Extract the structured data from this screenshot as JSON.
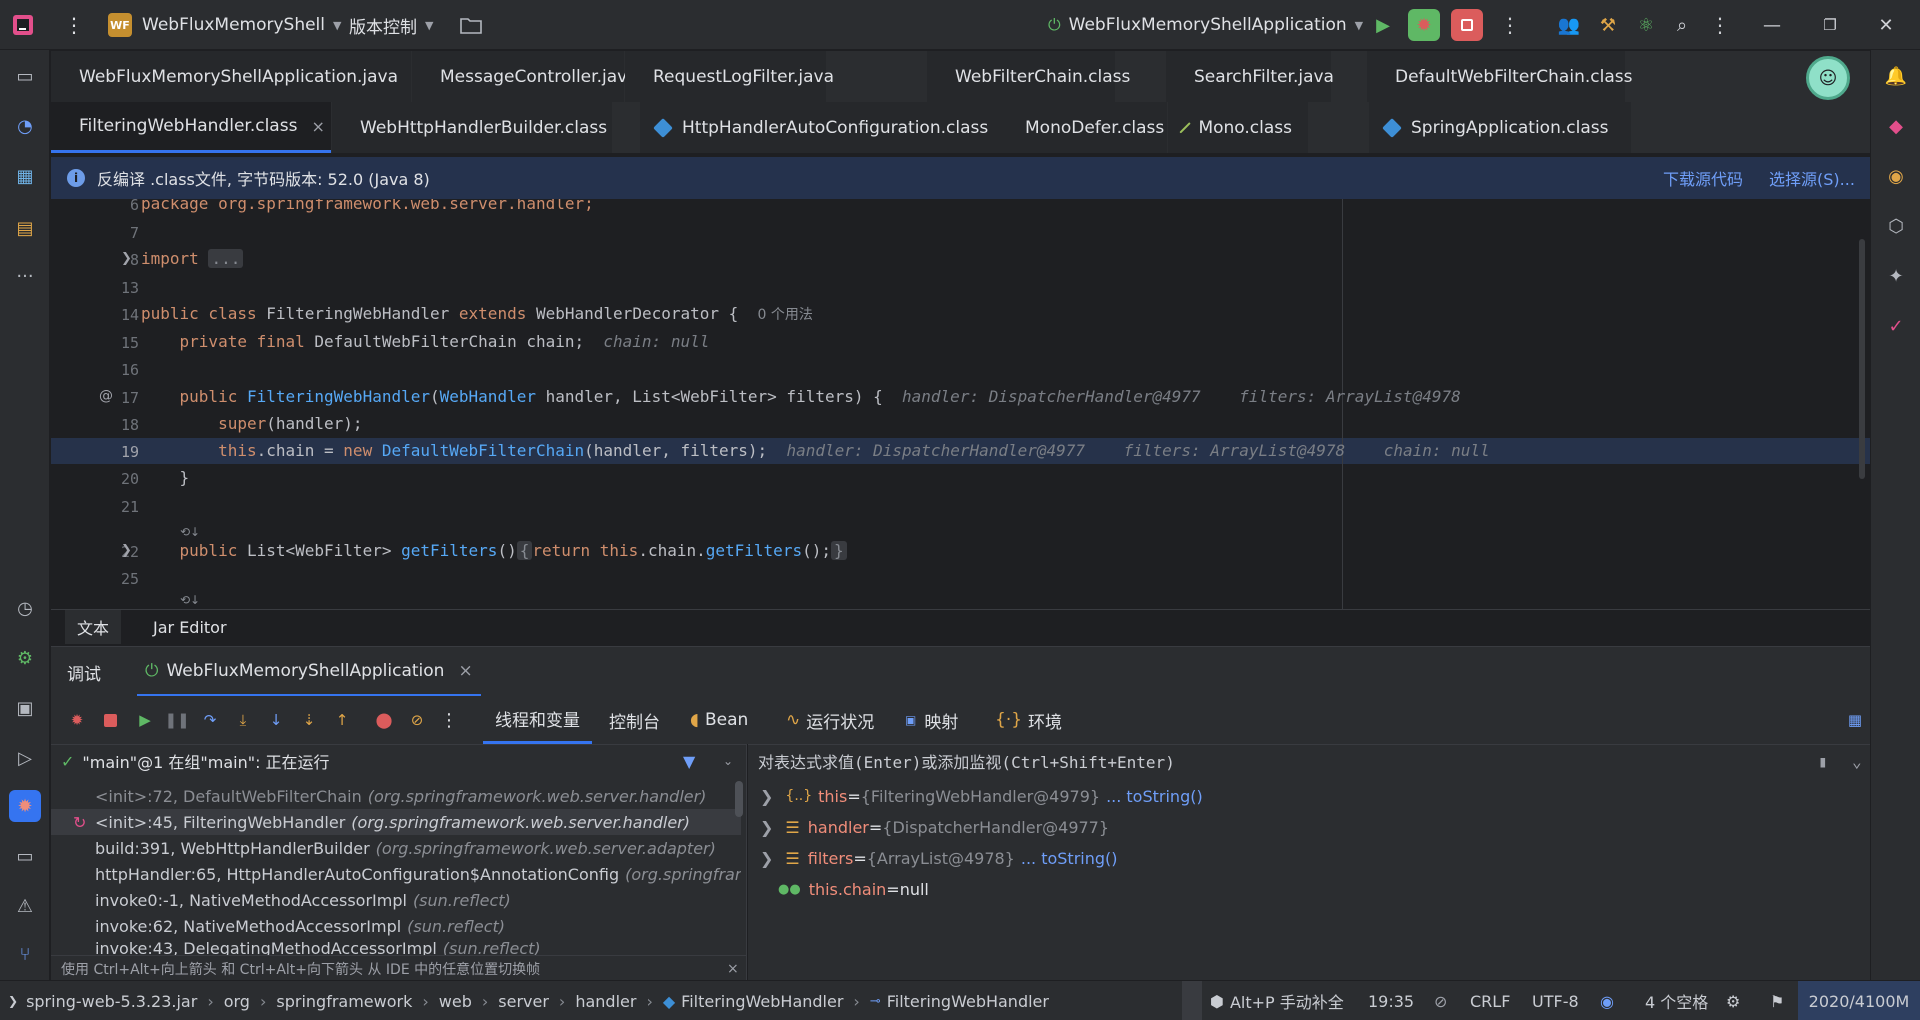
{
  "titlebar": {
    "project_badge": "WF",
    "project_name": "WebFluxMemoryShell",
    "vcs_label": "版本控制",
    "run_config": "WebFluxMemoryShellApplication"
  },
  "tabs_row1": [
    {
      "label": "WebFluxMemoryShellApplication.java",
      "icon": "spring-class-icon"
    },
    {
      "label": "MessageController.java",
      "icon": "class-icon"
    },
    {
      "label": "RequestLogFilter.java",
      "icon": "class-icon"
    },
    {
      "label": "WebFilterChain.class",
      "icon": "interface-icon"
    },
    {
      "label": "SearchFilter.java",
      "icon": "class-icon"
    },
    {
      "label": "DefaultWebFilterChain.class",
      "icon": "class-icon"
    }
  ],
  "tabs_row2": [
    {
      "label": "FilteringWebHandler.class",
      "icon": "class-icon",
      "close": "×"
    },
    {
      "label": "WebHttpHandlerBuilder.class",
      "icon": "class-icon"
    },
    {
      "label": "HttpHandlerAutoConfiguration.class",
      "icon": "class-icon"
    },
    {
      "label": "MonoDefer.class",
      "icon": "class-icon"
    },
    {
      "label": "Mono.class",
      "icon": "abstract-class-icon"
    },
    {
      "label": "SpringApplication.class",
      "icon": "class-icon"
    }
  ],
  "banner": {
    "text": "反编译 .class文件, 字节码版本: 52.0 (Java 8)",
    "download_link": "下载源代码",
    "choose_link": "选择源(S)..."
  },
  "editor": {
    "line_numbers": [
      "6",
      "7",
      "8",
      "13",
      "14",
      "15",
      "16",
      "17",
      "18",
      "19",
      "20",
      "21",
      "22",
      "25"
    ],
    "l6": "package org.springframework.web.server.handler;",
    "l8_kw": "import",
    "l8_fold": "...",
    "l14_a": "public class",
    "l14_b": "FilteringWebHandler",
    "l14_c": "extends",
    "l14_d": "WebHandlerDecorator {",
    "l14_usage": "0 个用法",
    "l15_a": "private final",
    "l15_b": "DefaultWebFilterChain chain;",
    "l15_hint": "chain: null",
    "l17_a": "public",
    "l17_b": "FilteringWebHandler",
    "l17_c": "(",
    "l17_d": "WebHandler",
    "l17_e": " handler, List<WebFilter> filters) {",
    "l17_hint1": "handler: DispatcherHandler@4977",
    "l17_hint2": "filters: ArrayList@4978",
    "l18_a": "super",
    "l18_b": "(handler);",
    "l19_a": "this",
    "l19_b": ".chain = ",
    "l19_c": "new",
    "l19_d": "DefaultWebFilterChain",
    "l19_e": "(handler, filters);",
    "l19_hint1": "handler: DispatcherHandler@4977",
    "l19_hint2": "filters: ArrayList@4978",
    "l19_hint3": "chain: null",
    "l20": "}",
    "l22_a": "public",
    "l22_b": "List<WebFilter>",
    "l22_c": "getFilters",
    "l22_d": "()",
    "l22_e": "{",
    "l22_f": "return",
    "l22_g": "this",
    "l22_h": ".chain.",
    "l22_i": "getFilters",
    "l22_j": "();",
    "l22_k": "}",
    "gutter_at": "@"
  },
  "editor_tabs": [
    "文本",
    "Jar Editor"
  ],
  "debug": {
    "panel_title": "调试",
    "session_tab": "WebFluxMemoryShellApplication",
    "view_tabs": [
      "线程和变量",
      "控制台",
      "Bean",
      "运行状况",
      "映射",
      "环境"
    ],
    "thread_label": "\"main\"@1 在组\"main\": 正在运行",
    "eval_placeholder": "对表达式求值(Enter)或添加监视(Ctrl+Shift+Enter)",
    "frames": [
      {
        "method": "<init>:72, DefaultWebFilterChain",
        "pkg": "(org.springframework.web.server.handler)"
      },
      {
        "method": "<init>:45, FilteringWebHandler",
        "pkg": "(org.springframework.web.server.handler)"
      },
      {
        "method": "build:391, WebHttpHandlerBuilder",
        "pkg": "(org.springframework.web.server.adapter)"
      },
      {
        "method": "httpHandler:65, HttpHandlerAutoConfiguration$AnnotationConfig",
        "pkg": "(org.springframew"
      },
      {
        "method": "invoke0:-1, NativeMethodAccessorImpl",
        "pkg": "(sun.reflect)"
      },
      {
        "method": "invoke:62, NativeMethodAccessorImpl",
        "pkg": "(sun.reflect)"
      },
      {
        "method": "invoke:43, DelegatingMethodAccessorImpl",
        "pkg": "(sun.reflect)"
      }
    ],
    "frames_hint": "使用 Ctrl+Alt+向上箭头 和 Ctrl+Alt+向下箭头 从 IDE 中的任意位置切换帧",
    "variables": [
      {
        "name": "this",
        "eq": " = ",
        "value": "{FilteringWebHandler@4979}",
        "link": "... toString()"
      },
      {
        "name": "handler",
        "eq": " = ",
        "value": "{DispatcherHandler@4977}",
        "link": ""
      },
      {
        "name": "filters",
        "eq": " = ",
        "value": "{ArrayList@4978}",
        "link": "... toString()"
      },
      {
        "name": "this.chain",
        "eq": " = ",
        "value": "null",
        "link": ""
      }
    ]
  },
  "statusbar": {
    "crumbs": [
      "spring-web-5.3.23.jar",
      "org",
      "springframework",
      "web",
      "server",
      "handler",
      "FilteringWebHandler",
      "FilteringWebHandler"
    ],
    "completion": "Alt+P 手动补全",
    "position": "19:35",
    "line_sep": "CRLF",
    "encoding": "UTF-8",
    "indent": "4 个空格",
    "memory": "2020/4100M"
  },
  "colors": {
    "accent": "#3574f0",
    "debug_red": "#db5c5c",
    "debug_green": "#5fb865"
  }
}
